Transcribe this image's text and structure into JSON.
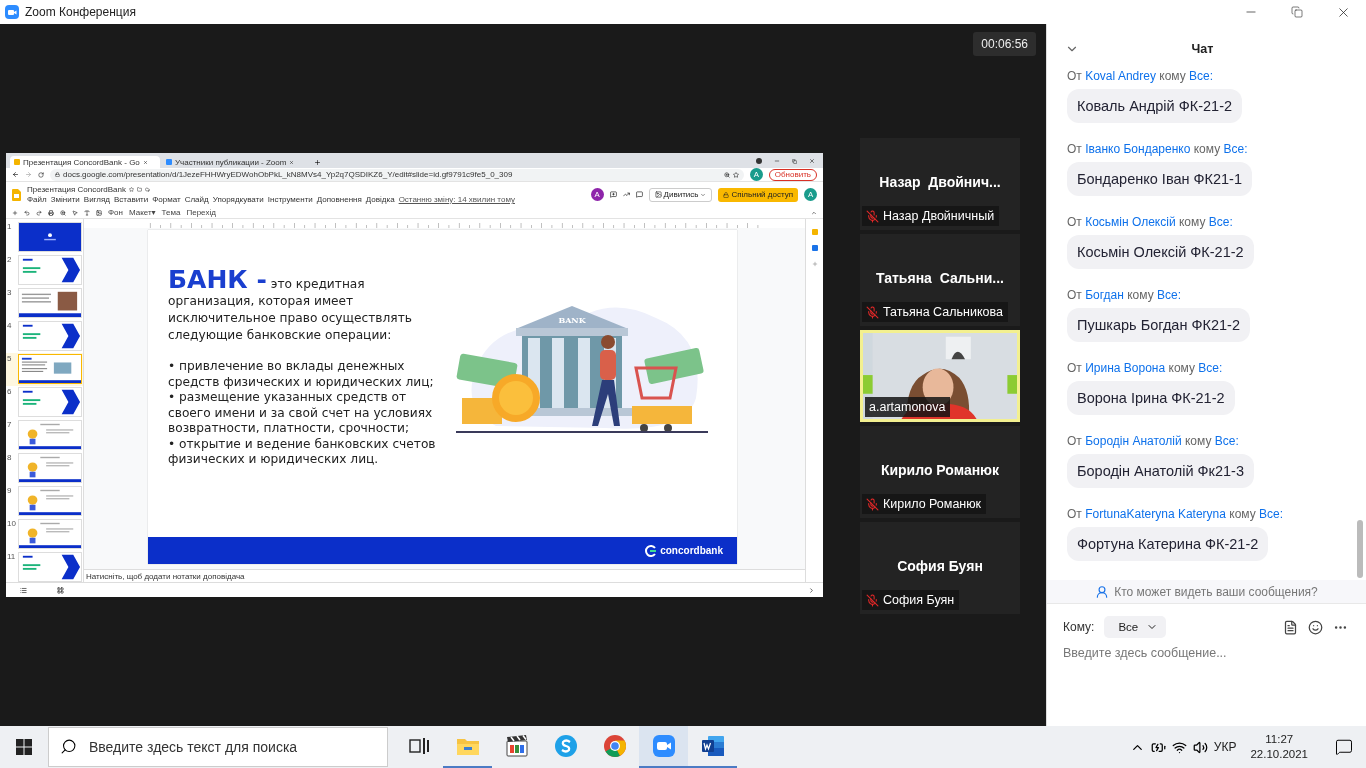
{
  "window": {
    "title": "Zoom Конференция"
  },
  "meeting": {
    "timer": "00:06:56"
  },
  "shared_screen": {
    "browser_tabs": [
      {
        "title": "Презентация ConcordBank - Go",
        "selected": true
      },
      {
        "title": "Участники публикации - Zoom",
        "selected": false
      }
    ],
    "url": "docs.google.com/presentation/d/1JezeFHHWryEDWohObPkL_kN8MVs4_Yp2q7QSDIKZ6_Y/edit#slide=id.gf9791c9fe5_0_309",
    "profile_avatar": "A",
    "update_button": "Обновить",
    "doc_title": "Презентация ConcordBank",
    "menu": [
      "Файл",
      "Змінити",
      "Вигляд",
      "Вставити",
      "Формат",
      "Слайд",
      "Упорядкувати",
      "Інструменти",
      "Доповнення",
      "Довідка"
    ],
    "last_edit": "Останню зміну: 14 хвилин тому",
    "collaborator_avatar": "A",
    "view_button": "Дивитись",
    "share_button": "Спільний доступ",
    "account_avatar": "A",
    "toolbar_items": [
      "Фон",
      "Макет▾",
      "Тема",
      "Перехід"
    ],
    "filmstrip": [
      {
        "number": "1",
        "kind": "cover",
        "selected": false
      },
      {
        "number": "2",
        "kind": "section",
        "selected": false
      },
      {
        "number": "3",
        "selected": false
      },
      {
        "number": "4",
        "kind": "section",
        "selected": false
      },
      {
        "number": "5",
        "kind": "bank",
        "selected": true
      },
      {
        "number": "6",
        "kind": "section",
        "selected": false
      },
      {
        "number": "7",
        "kind": "sketch",
        "selected": false
      },
      {
        "number": "8",
        "kind": "sketch",
        "selected": false
      },
      {
        "number": "9",
        "kind": "sketch",
        "selected": false
      },
      {
        "number": "10",
        "kind": "sketch",
        "selected": false
      },
      {
        "number": "11",
        "kind": "section",
        "selected": false
      }
    ],
    "slide": {
      "heading": "БАНК -",
      "lead": "это кредитная организация, которая имеет исключительное право осуществлять следующие банковские операции:",
      "bullets": [
        "• привлечение во вклады денежных средств физических и юридических лиц;",
        "• размещение указанных средств от своего имени и за свой счет на условиях возвратности, платности, срочности;",
        "• открытие и ведение банковских счетов физических и юридических лиц."
      ],
      "illustration_sign": "BANK",
      "logo": "concordbank"
    },
    "notes_placeholder": "Натисніть, щоб додати нотатки доповідача"
  },
  "participants": [
    {
      "kind": "avatar",
      "display_name": "Назар  Двойнич...",
      "label": "Назар Двойничный",
      "muted": true,
      "speaking": false
    },
    {
      "kind": "avatar",
      "display_name": "Татьяна  Сальни...",
      "label": "Татьяна Сальникова",
      "muted": true,
      "speaking": false
    },
    {
      "kind": "video",
      "label": "a.artamonova",
      "muted": false,
      "speaking": true
    },
    {
      "kind": "avatar",
      "display_name": "Кирило Романюк",
      "label": "Кирило Романюк",
      "muted": true,
      "speaking": false
    },
    {
      "kind": "avatar",
      "display_name": "София Буян",
      "label": "София Буян",
      "muted": true,
      "speaking": false
    }
  ],
  "chat": {
    "title": "Чат",
    "messages": [
      {
        "from_label": "От",
        "sender": "Koval Andrey",
        "to_label": "кому",
        "recipient": "Все:",
        "text": "Коваль Андрій ФК-21-2"
      },
      {
        "from_label": "От",
        "sender": "Іванко Бондаренко",
        "to_label": "кому",
        "recipient": "Все:",
        "text": "Бондаренко Іван ФК21-1"
      },
      {
        "from_label": "От",
        "sender": "Косьмін Олексій",
        "to_label": "кому",
        "recipient": "Все:",
        "text": "Косьмін Олексій ФК-21-2"
      },
      {
        "from_label": "От",
        "sender": "Богдан",
        "to_label": "кому",
        "recipient": "Все:",
        "text": "Пушкарь Богдан ФК21-2"
      },
      {
        "from_label": "От",
        "sender": "Ирина Ворона",
        "to_label": "кому",
        "recipient": "Все:",
        "text": "Ворона Ірина ФК-21-2"
      },
      {
        "from_label": "От",
        "sender": "Бородін Анатолій",
        "to_label": "кому",
        "recipient": "Все:",
        "text": "Бородін Анатолій Фк21-3"
      },
      {
        "from_label": "От",
        "sender": "FortunaKateryna Kateryna",
        "to_label": "кому",
        "recipient": "Все:",
        "text": "Фортуна Катерина ФК-21-2"
      }
    ],
    "privacy_note": "Кто может видеть ваши сообщения?",
    "to_label": "Кому:",
    "recipient_select": "Все",
    "input_placeholder": "Введите здесь сообщение..."
  },
  "taskbar": {
    "search_placeholder": "Введите здесь текст для поиска",
    "apps": [
      {
        "kind": "taskview",
        "running": false,
        "selected": false
      },
      {
        "kind": "explorer",
        "running": true,
        "selected": false
      },
      {
        "kind": "media",
        "running": false,
        "selected": false
      },
      {
        "kind": "skype",
        "running": false,
        "selected": false
      },
      {
        "kind": "chrome",
        "running": false,
        "selected": false
      },
      {
        "kind": "zoom",
        "running": true,
        "selected": true
      },
      {
        "kind": "word",
        "running": true,
        "selected": false
      }
    ],
    "language": "УКР",
    "time": "11:27",
    "date": "22.10.2021"
  }
}
